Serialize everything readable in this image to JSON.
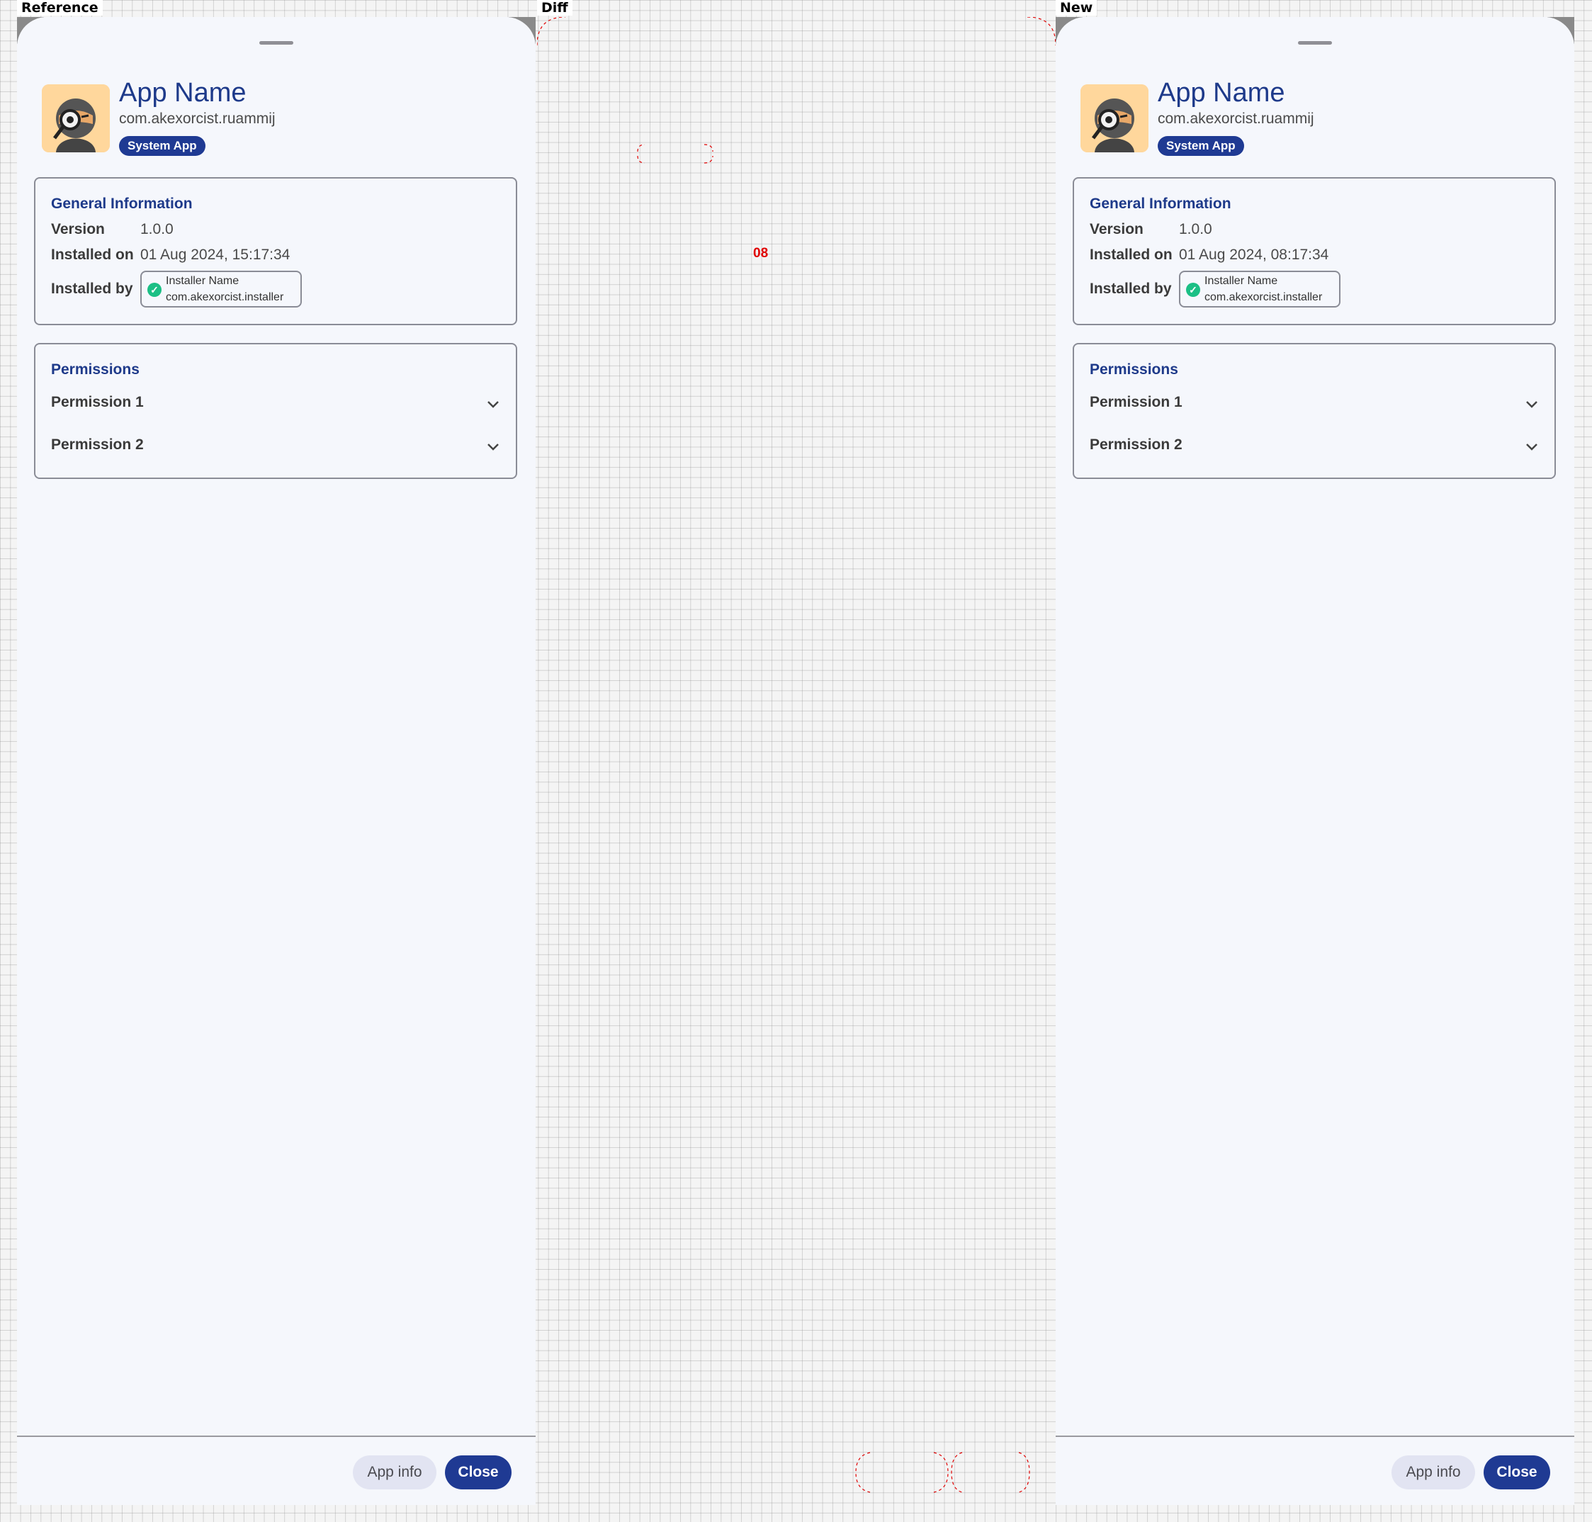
{
  "labels": {
    "reference": "Reference",
    "diff": "Diff",
    "new": "New"
  },
  "reference": {
    "app_name": "App Name",
    "package": "com.akexorcist.ruammij",
    "badge": "System App",
    "general": {
      "title": "General Information",
      "version_label": "Version",
      "version_value": "1.0.0",
      "installed_on_label": "Installed on",
      "installed_on_value": "01 Aug 2024, 15:17:34",
      "installed_by_label": "Installed by",
      "installer_name": "Installer Name",
      "installer_package": "com.akexorcist.installer"
    },
    "permissions": {
      "title": "Permissions",
      "items": [
        {
          "label": "Permission 1"
        },
        {
          "label": "Permission 2"
        }
      ]
    },
    "buttons": {
      "app_info": "App info",
      "close": "Close"
    }
  },
  "new": {
    "app_name": "App Name",
    "package": "com.akexorcist.ruammij",
    "badge": "System App",
    "general": {
      "title": "General Information",
      "version_label": "Version",
      "version_value": "1.0.0",
      "installed_on_label": "Installed on",
      "installed_on_value": "01 Aug 2024, 08:17:34",
      "installed_by_label": "Installed by",
      "installer_name": "Installer Name",
      "installer_package": "com.akexorcist.installer"
    },
    "permissions": {
      "title": "Permissions",
      "items": [
        {
          "label": "Permission 1"
        },
        {
          "label": "Permission 2"
        }
      ]
    },
    "buttons": {
      "app_info": "App info",
      "close": "Close"
    }
  },
  "diff": {
    "changed_digits": "08"
  },
  "colors": {
    "accent": "#1f3a93",
    "title": "#1e3a8a",
    "check": "#1bbf85",
    "diff": "#e00000"
  }
}
